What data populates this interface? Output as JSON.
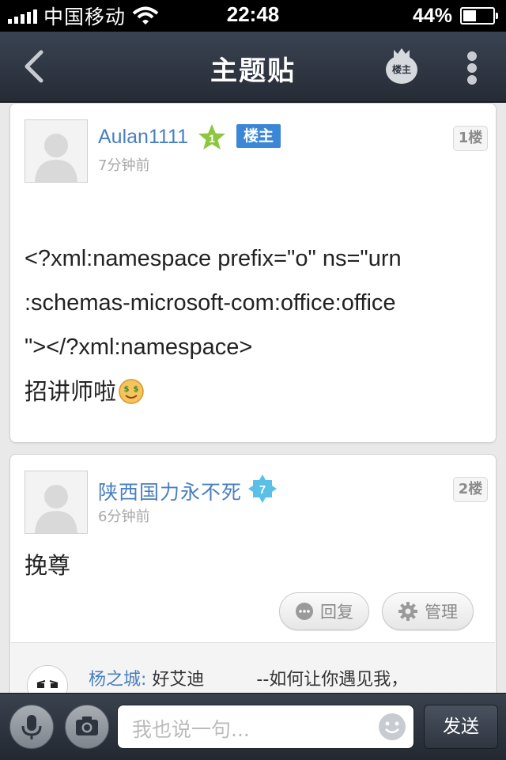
{
  "status_bar": {
    "carrier": "中国移动",
    "time": "22:48",
    "battery_text": "44%",
    "battery_level": 0.44
  },
  "nav": {
    "title": "主题贴",
    "owner_only_label": "楼主",
    "back_icon": "chevron-left-icon",
    "more_icon": "more-vertical-icon"
  },
  "posts": [
    {
      "username": "Aulan1111",
      "level": "1",
      "level_color": "#8dc63f",
      "owner_badge": "楼主",
      "time": "7分钟前",
      "floor": "1楼",
      "lines": [
        "<?xml:namespace prefix=\"o\" ns=\"urn",
        ":schemas-microsoft-com:office:office",
        "\"></?xml:namespace>"
      ],
      "last_line": "招讲师啦",
      "emoji_icon": "money-face-emoji-icon"
    },
    {
      "username": "陕西国力永不死",
      "level": "7",
      "level_color": "#5bc0e8",
      "time": "6分钟前",
      "floor": "2楼",
      "text": "挽尊",
      "reply_button": "回复",
      "manage_button": "管理",
      "sub_reply": {
        "author": "杨之城:",
        "text": "好艾迪　　　--如何让你遇见我，"
      }
    }
  ],
  "bottom_bar": {
    "input_placeholder": "我也说一句...",
    "send_label": "发送",
    "mic_icon": "microphone-icon",
    "camera_icon": "camera-icon",
    "emoji_icon": "smiley-icon"
  },
  "colors": {
    "link_blue": "#4a7fbf",
    "owner_badge_bg": "#3b86d6",
    "nav_bg": "#2f3642"
  }
}
